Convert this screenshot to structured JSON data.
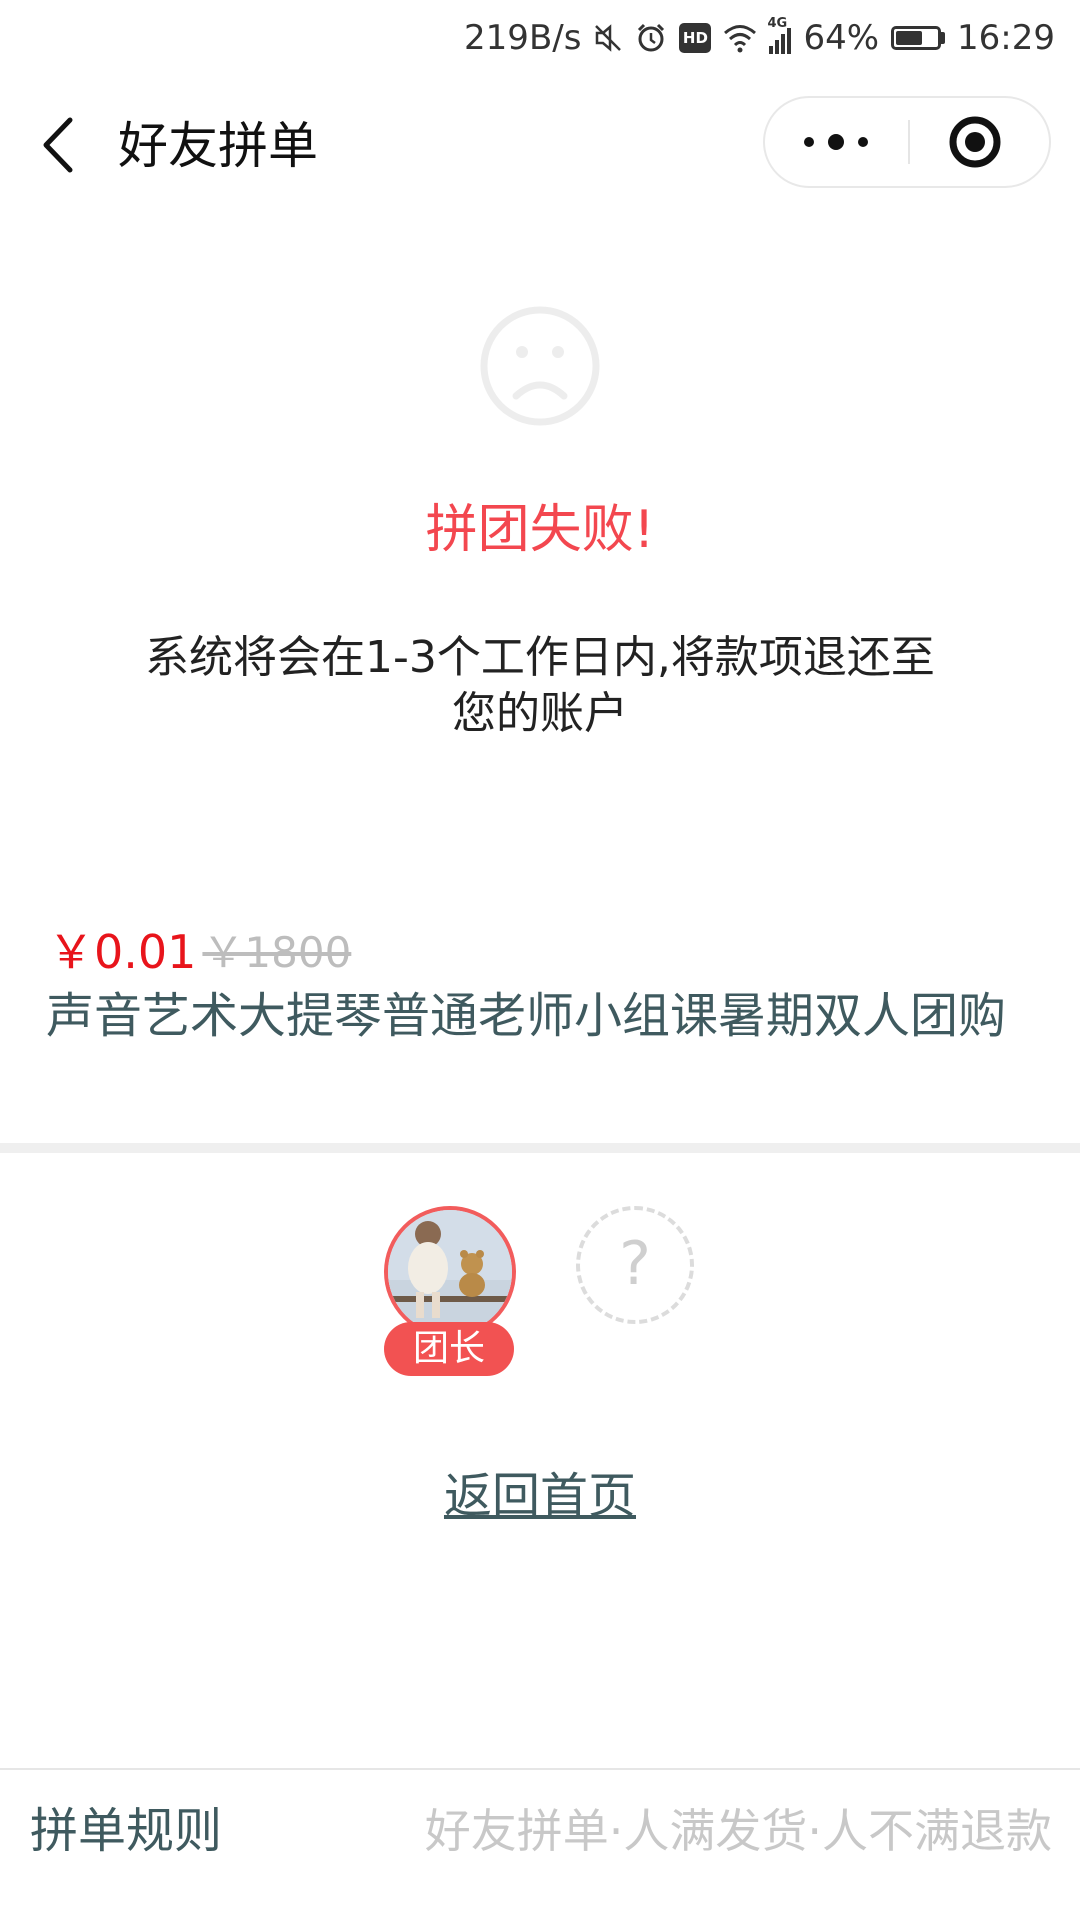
{
  "status_bar": {
    "net_speed": "219B/s",
    "network": "4G",
    "battery": "64%",
    "battery_level": 0.64,
    "time": "16:29"
  },
  "nav": {
    "title": "好友拼单"
  },
  "result": {
    "title": "拼团失败!",
    "description": "系统将会在1-3个工作日内,将款项退还至您的账户"
  },
  "product": {
    "price": "￥0.01",
    "original_price": "￥1800",
    "name": "声音艺术大提琴普通老师小组课暑期双人团购"
  },
  "members": {
    "leader_badge": "团长",
    "empty_slot_symbol": "?"
  },
  "home_link": "返回首页",
  "bottom_bar": {
    "rules_label": "拼单规则",
    "rules_summary": "好友拼单·人满发货·人不满退款"
  },
  "colors": {
    "accent_red": "#f3474f",
    "price_red": "#e8141b",
    "text_teal": "#3f5a5f"
  }
}
